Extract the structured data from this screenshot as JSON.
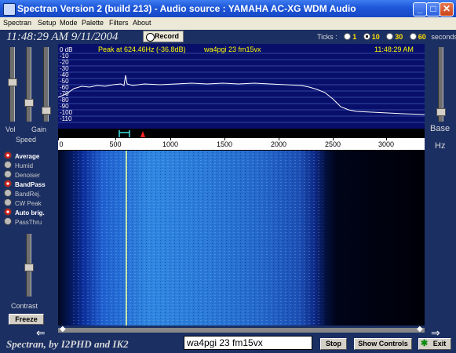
{
  "window": {
    "title": "Spectran Version 2  (build 213) - Audio source  :  YAMAHA AC-XG WDM Audio"
  },
  "menu": [
    "Spectran",
    "Setup",
    "Mode",
    "Palette",
    "Filters",
    "About"
  ],
  "clock": "11:48:29 AM 9/11/2004",
  "record_label": "Record",
  "ticks": {
    "label": "Ticks :",
    "options": [
      "1",
      "10",
      "30",
      "60"
    ],
    "selected": "10",
    "unit": "seconds"
  },
  "spectrum": {
    "peak_text": "Peak at   624.46Hz (-36.8dB)",
    "call_text": "wa4pgi 23 fm15vx",
    "time_text": "11:48:29 AM",
    "db_labels": [
      "0 dB",
      "-10",
      "-20",
      "-30",
      "-40",
      "-50",
      "-60",
      "-70",
      "-80",
      "-90",
      "-100",
      "-110"
    ]
  },
  "freq_scale": [
    "0",
    "500",
    "1000",
    "1500",
    "2000",
    "2500",
    "3000"
  ],
  "left_panel": {
    "vol": "Vol",
    "gain": "Gain",
    "speed": "Speed",
    "contrast": "Contrast",
    "freeze": "Freeze",
    "options": [
      {
        "label": "Average",
        "on": true
      },
      {
        "label": "Humid",
        "on": false
      },
      {
        "label": "Denoiser",
        "on": false
      },
      {
        "label": "BandPass",
        "on": true
      },
      {
        "label": "BandRej.",
        "on": false
      },
      {
        "label": "CW Peak",
        "on": false
      },
      {
        "label": "Auto brig.",
        "on": true
      },
      {
        "label": "PassThru",
        "on": false
      }
    ]
  },
  "right_panel": {
    "base": "Base",
    "hz": "Hz"
  },
  "bottom": {
    "credit": "Spectran, by I2PHD and IK2",
    "message": "wa4pgi 23 fm15vx",
    "stop": "Stop",
    "show_controls": "Show Controls",
    "exit": "Exit"
  },
  "colors": {
    "title_bar": "#2358d8",
    "spectrum_bg": "#080f6a",
    "accent_yellow": "#ffff00",
    "option_on": "#d01c1c"
  }
}
